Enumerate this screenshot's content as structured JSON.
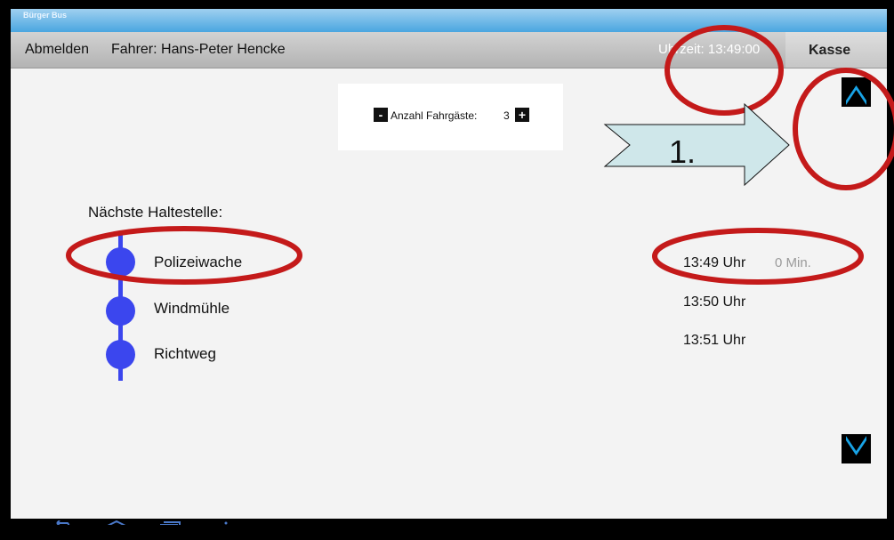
{
  "app": {
    "title": "Bürger Bus"
  },
  "header": {
    "logout_label": "Abmelden",
    "driver_label": "Fahrer: Hans-Peter Hencke",
    "time_label": "Uhrzeit: 13:49:00",
    "cash_label": "Kasse"
  },
  "passengers": {
    "minus_label": "-",
    "label": "Anzahl Fahrgäste:",
    "count": "3",
    "plus_label": "+"
  },
  "stops": {
    "title": "Nächste Haltestelle:",
    "items": [
      {
        "name": "Polizeiwache",
        "time": "13:49 Uhr",
        "minutes": "0 Min."
      },
      {
        "name": "Windmühle",
        "time": "13:50 Uhr"
      },
      {
        "name": "Richtweg",
        "time": "13:51 Uhr"
      }
    ]
  },
  "annotation": {
    "step_label": "1."
  },
  "colors": {
    "route": "#3b46ee",
    "annotation_ring": "#c41a1a",
    "arrow_fill": "#cfe7ea",
    "scroll_icon": "#18a3e6"
  },
  "icons": [
    "scroll-up-icon",
    "scroll-down-icon",
    "back-icon",
    "home-icon",
    "recent-apps-icon",
    "menu-icon"
  ]
}
